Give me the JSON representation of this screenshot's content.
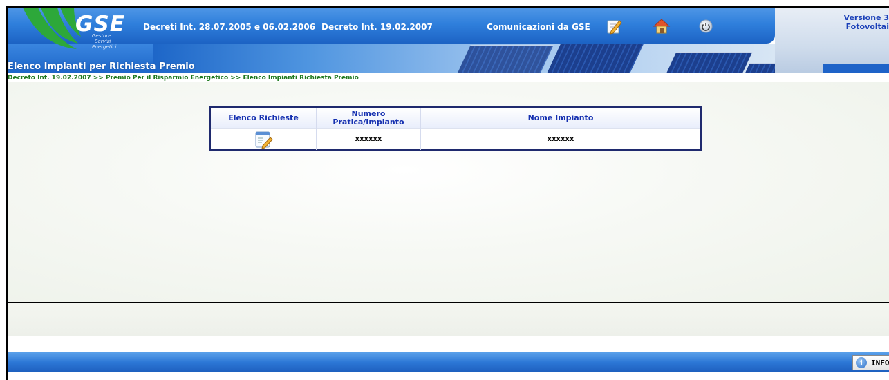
{
  "header": {
    "logo_text": "GSE",
    "logo_subtitle": [
      "Gestore",
      "Servizi",
      "Energetici"
    ],
    "nav": [
      {
        "label": "Decreti Int. 28.07.2005 e 06.02.2006"
      },
      {
        "label": "Decreto Int. 19.02.2007"
      },
      {
        "label": "Comunicazioni da GSE"
      }
    ],
    "icons": [
      "edit-icon",
      "home-icon",
      "power-icon"
    ],
    "version_line1": "Versione 3",
    "version_line2": "Fotovoltai",
    "page_title": "Elenco Impianti per Richiesta Premio"
  },
  "breadcrumb": {
    "items": [
      "Decreto Int. 19.02.2007",
      "Premio Per il Risparmio Energetico",
      "Elenco Impianti Richiesta Premio"
    ],
    "separator": " >> "
  },
  "table": {
    "headers": [
      "Elenco Richieste",
      "Numero Pratica/Impianto",
      "Nome Impianto"
    ],
    "rows": [
      {
        "icon": "edit-document-icon",
        "numero": "xxxxxx",
        "nome": "xxxxxx"
      }
    ]
  },
  "footer": {
    "info_label": "INFO"
  },
  "colors": {
    "header_blue": "#2f7fdc",
    "breadcrumb_green": "#1f7a1f",
    "table_header_text": "#1530b0",
    "table_border": "#1f2a6e"
  }
}
